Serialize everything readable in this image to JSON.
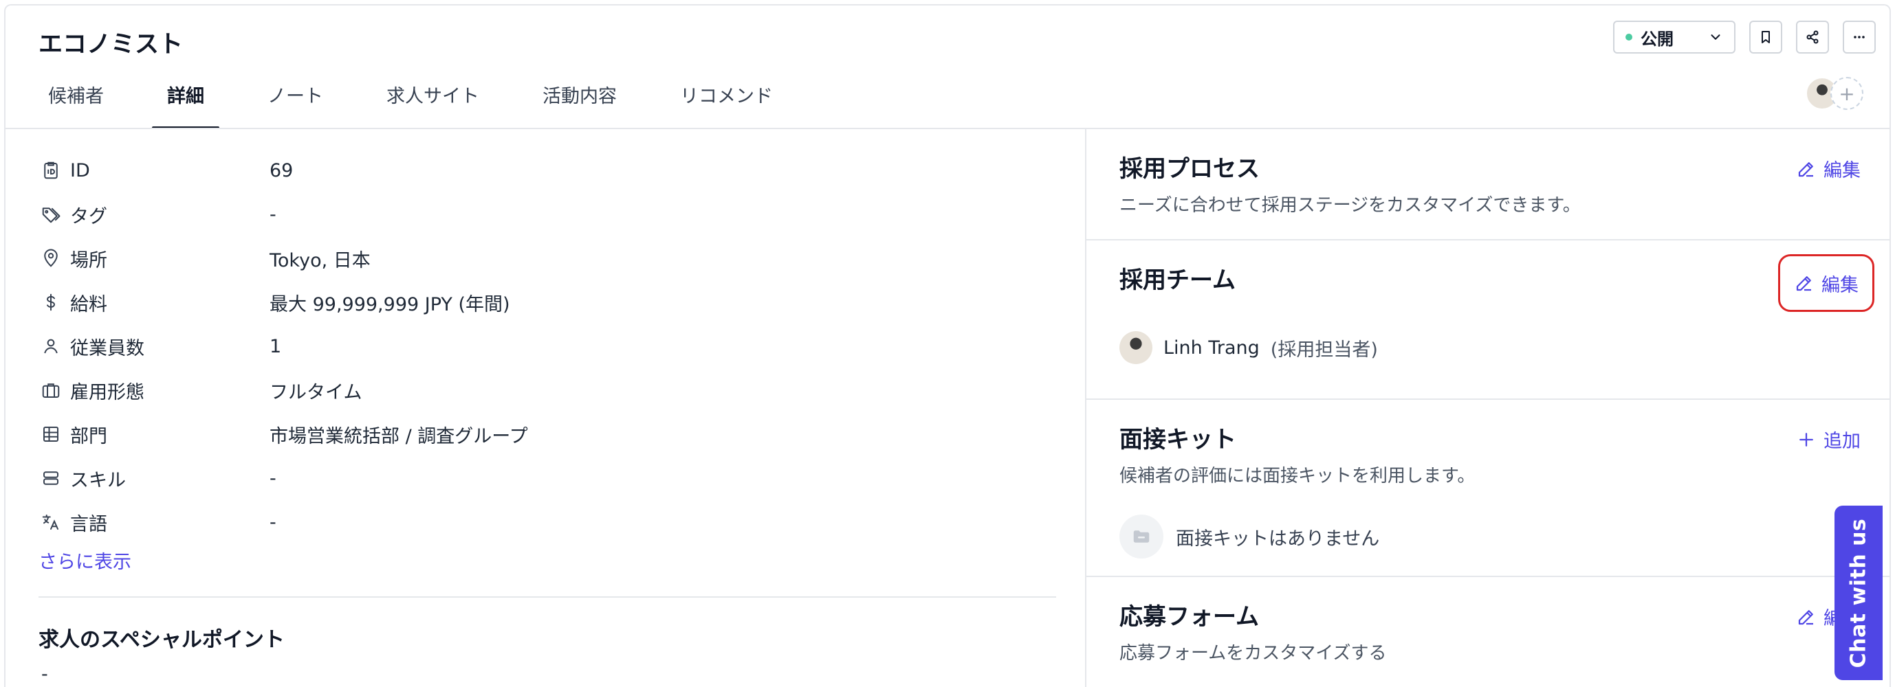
{
  "header": {
    "title": "エコノミスト",
    "status": "公開",
    "tabs": [
      "候補者",
      "詳細",
      "ノート",
      "求人サイト",
      "活動内容",
      "リコメンド"
    ],
    "active_tab": "詳細"
  },
  "details": {
    "rows": [
      {
        "icon": "id-badge-icon",
        "label": "ID",
        "value": "69"
      },
      {
        "icon": "tag-icon",
        "label": "タグ",
        "value": "-"
      },
      {
        "icon": "location-pin-icon",
        "label": "場所",
        "value": "Tokyo, 日本"
      },
      {
        "icon": "dollar-icon",
        "label": "給料",
        "value": "最大 99,999,999 JPY (年間)"
      },
      {
        "icon": "user-icon",
        "label": "従業員数",
        "value": "1"
      },
      {
        "icon": "briefcase-icon",
        "label": "雇用形態",
        "value": "フルタイム"
      },
      {
        "icon": "table-icon",
        "label": "部門",
        "value": "市場営業統括部 / 調査グループ"
      },
      {
        "icon": "layers-icon",
        "label": "スキル",
        "value": "-"
      },
      {
        "icon": "translate-icon",
        "label": "言語",
        "value": "-"
      }
    ],
    "more_link": "さらに表示",
    "special_title": "求人のスペシャルポイント",
    "special_value": "-"
  },
  "right": {
    "process": {
      "title": "採用プロセス",
      "desc": "ニーズに合わせて採用ステージをカスタマイズできます。",
      "action": "編集"
    },
    "team": {
      "title": "採用チーム",
      "action": "編集",
      "member_name": "Linh Trang",
      "member_role": "(採用担当者)"
    },
    "kit": {
      "title": "面接キット",
      "desc": "候補者の評価には面接キットを利用します。",
      "action": "追加",
      "empty": "面接キットはありません"
    },
    "form": {
      "title": "応募フォーム",
      "desc": "応募フォームをカスタマイズする",
      "action": "編集"
    }
  },
  "chat": {
    "label": "Chat with us"
  },
  "colors": {
    "accent": "#4f46e5",
    "highlight": "#dc2626",
    "status": "#10b981"
  }
}
